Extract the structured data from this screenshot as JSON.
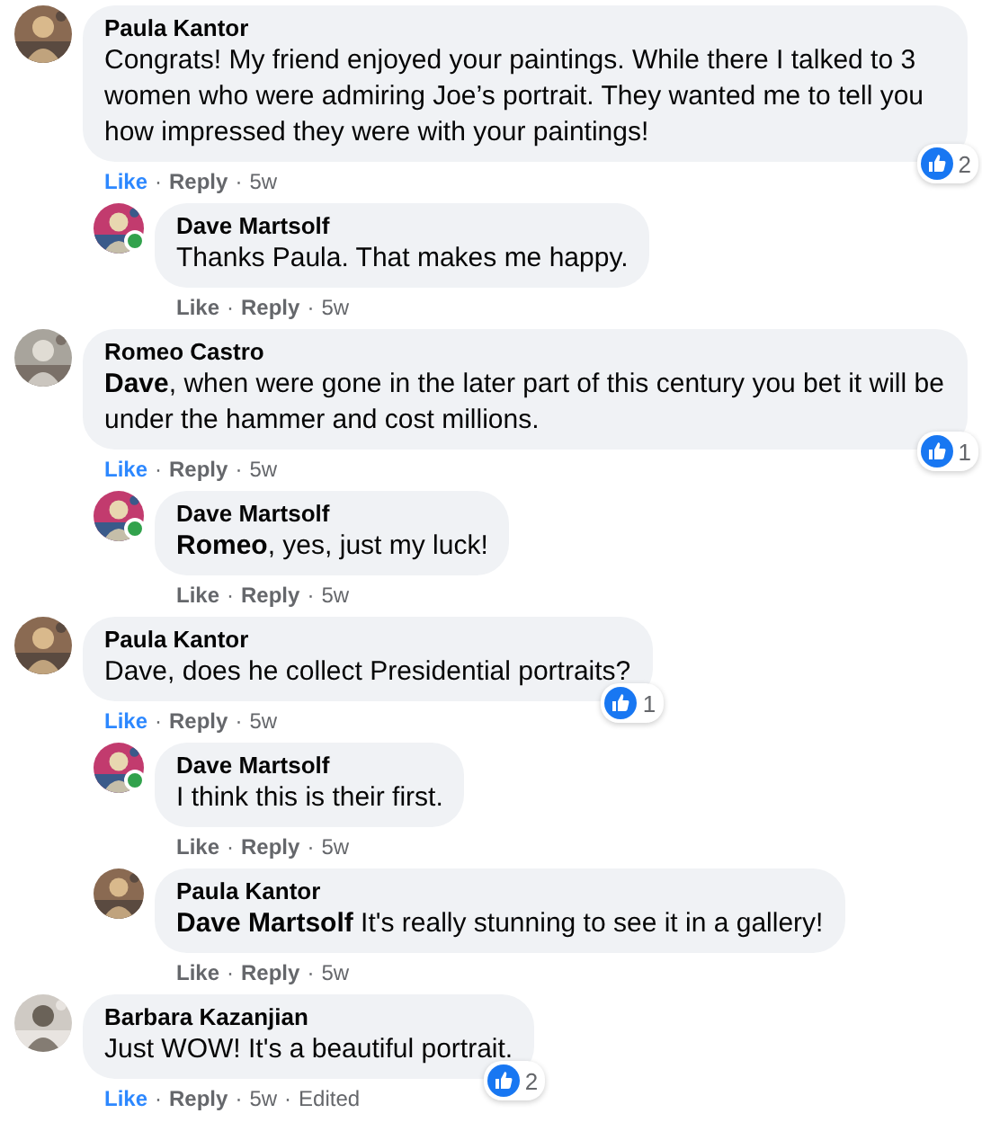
{
  "separator": "·",
  "comments": [
    {
      "author": "Paula Kantor",
      "online": false,
      "text": "Congrats! My friend enjoyed your paintings. While there I talked to 3 women who were admiring Joe’s portrait. They wanted me to tell you how impressed they were with your paintings!",
      "reactions": "2",
      "like": "Like",
      "liked": true,
      "reply": "Reply",
      "time": "5w",
      "replies": [
        {
          "author": "Dave Martsolf",
          "online": true,
          "text": "Thanks Paula. That makes me happy.",
          "like": "Like",
          "liked": false,
          "reply": "Reply",
          "time": "5w"
        }
      ]
    },
    {
      "author": "Romeo Castro",
      "online": false,
      "text": "**Dave**, when were gone in the later part of this century you bet it will be under the hammer and cost millions.",
      "reactions": "1",
      "like": "Like",
      "liked": true,
      "reply": "Reply",
      "time": "5w",
      "replies": [
        {
          "author": "Dave Martsolf",
          "online": true,
          "text": "**Romeo**, yes, just my luck!",
          "like": "Like",
          "liked": false,
          "reply": "Reply",
          "time": "5w"
        }
      ]
    },
    {
      "author": "Paula Kantor",
      "online": false,
      "text": "Dave, does he collect Presidential portraits?",
      "reactions": "1",
      "like": "Like",
      "liked": true,
      "reply": "Reply",
      "time": "5w",
      "replies": [
        {
          "author": "Dave Martsolf",
          "online": true,
          "text": "I think this is their first.",
          "like": "Like",
          "liked": false,
          "reply": "Reply",
          "time": "5w"
        },
        {
          "author": "Paula Kantor",
          "online": false,
          "text": "**Dave Martsolf** It's really stunning to see it in a gallery!",
          "like": "Like",
          "liked": false,
          "reply": "Reply",
          "time": "5w"
        }
      ]
    },
    {
      "author": "Barbara Kazanjian",
      "online": false,
      "text": "Just WOW! It's a beautiful portrait.",
      "reactions": "2",
      "like": "Like",
      "liked": true,
      "reply": "Reply",
      "time": "5w",
      "edited": "Edited"
    }
  ]
}
